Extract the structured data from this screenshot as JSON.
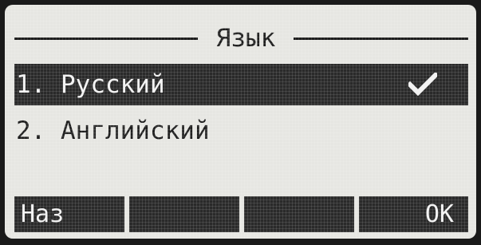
{
  "screen": {
    "title": "Язык"
  },
  "menu": {
    "items": [
      {
        "label": "1. Русский",
        "selected": true,
        "checked": true
      },
      {
        "label": "2. Английский",
        "selected": false,
        "checked": false
      }
    ]
  },
  "softkeys": {
    "labels": [
      "Наз",
      "",
      "",
      "OK"
    ]
  },
  "colors": {
    "screen_bg": "#e6e6e2",
    "ink": "#1e1e1e",
    "highlight_bg": "#2a2a2a",
    "highlight_text": "#f2f2f2",
    "bezel": "#1a1a1a"
  },
  "icons": {
    "selected_marker": "check-icon"
  }
}
